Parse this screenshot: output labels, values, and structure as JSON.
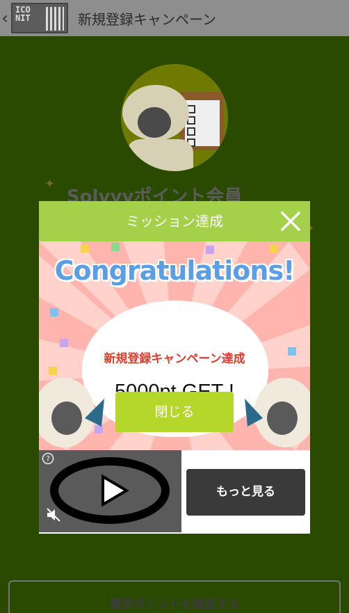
{
  "header": {
    "title": "新規登録キャンペーン",
    "back_icon": "chevron-left-icon",
    "logo_text": "ICO\nNIT"
  },
  "page": {
    "title": "Solvyyポイント会員",
    "confirm_button": "獲得ポイントを確認する"
  },
  "modal": {
    "title": "ミッション達成",
    "close_icon": "close-icon",
    "congrats": "Congratulations!",
    "campaign": "新規登録キャンペーン達成",
    "points": "5000pt GET !",
    "close_button": "閉じる"
  },
  "ad": {
    "more_button": "もっと見る",
    "help_icon": "help-icon",
    "play_icon": "play-icon",
    "mute_icon": "mute-icon"
  },
  "colors": {
    "background": "#2a4a00",
    "modal_header": "#a5d04a",
    "close_button": "#b5d62a",
    "campaign_text": "#e03c2c",
    "congrats_text": "#5a9ee6"
  }
}
